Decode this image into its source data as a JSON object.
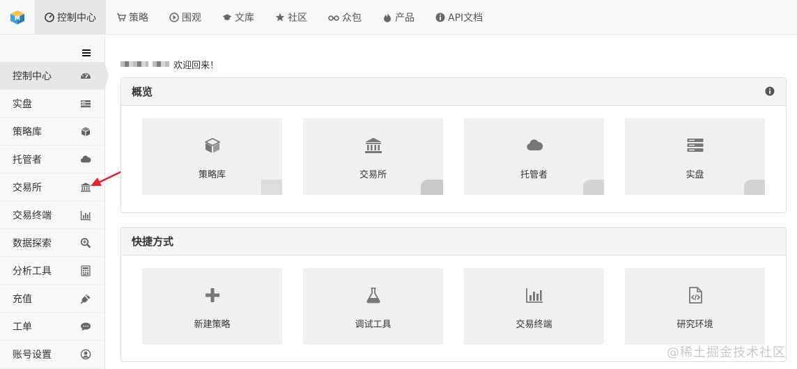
{
  "topnav": {
    "items": [
      {
        "label": "控制中心",
        "icon": "dashboard-icon"
      },
      {
        "label": "策略",
        "icon": "cart-icon"
      },
      {
        "label": "围观",
        "icon": "play-circle-icon"
      },
      {
        "label": "文库",
        "icon": "graduation-cap-icon"
      },
      {
        "label": "社区",
        "icon": "star-icon"
      },
      {
        "label": "众包",
        "icon": "glasses-icon"
      },
      {
        "label": "产品",
        "icon": "fire-icon"
      },
      {
        "label": "API文档",
        "icon": "info-circle-icon"
      }
    ]
  },
  "sidebar": {
    "items": [
      {
        "label": "控制中心",
        "icon": "dashboard-icon"
      },
      {
        "label": "实盘",
        "icon": "server-list-icon"
      },
      {
        "label": "策略库",
        "icon": "cube-icon"
      },
      {
        "label": "托管者",
        "icon": "cloud-icon"
      },
      {
        "label": "交易所",
        "icon": "bank-icon"
      },
      {
        "label": "交易终端",
        "icon": "bar-chart-icon"
      },
      {
        "label": "数据探索",
        "icon": "zoom-icon"
      },
      {
        "label": "分析工具",
        "icon": "calculator-icon"
      },
      {
        "label": "充值",
        "icon": "plug-icon"
      },
      {
        "label": "工单",
        "icon": "comment-icon"
      },
      {
        "label": "账号设置",
        "icon": "user-circle-icon"
      }
    ]
  },
  "welcome": {
    "text": "欢迎回来！"
  },
  "overview": {
    "title": "概览",
    "tiles": [
      {
        "label": "策略库",
        "icon": "cube-icon"
      },
      {
        "label": "交易所",
        "icon": "bank-icon"
      },
      {
        "label": "托管者",
        "icon": "cloud-icon"
      },
      {
        "label": "实盘",
        "icon": "server-list-icon"
      }
    ]
  },
  "shortcuts": {
    "title": "快捷方式",
    "tiles": [
      {
        "label": "新建策略",
        "icon": "plus-icon"
      },
      {
        "label": "调试工具",
        "icon": "flask-icon"
      },
      {
        "label": "交易终端",
        "icon": "bar-chart-icon"
      },
      {
        "label": "研究环境",
        "icon": "code-file-icon"
      }
    ]
  },
  "watermark": "@稀土掘金技术社区",
  "colors": {
    "topbar_bg": "#f8f8f8",
    "active_bg": "#e7e7e7",
    "tile_bg": "#f0f0f2",
    "icon_gray": "#777777",
    "annotation_red": "#e0252b"
  }
}
